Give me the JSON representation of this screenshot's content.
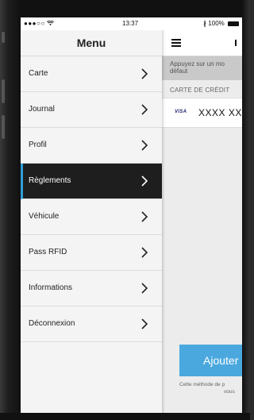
{
  "status_bar": {
    "signal": "●●●○○",
    "time": "13:37",
    "battery_text": "100%"
  },
  "menu": {
    "title": "Menu",
    "items": [
      {
        "label": "Carte"
      },
      {
        "label": "Journal"
      },
      {
        "label": "Profil"
      },
      {
        "label": "Règlements"
      },
      {
        "label": "Véhicule"
      },
      {
        "label": "Pass RFID"
      },
      {
        "label": "Informations"
      },
      {
        "label": "Déconnexion"
      }
    ],
    "active_index": 3
  },
  "content": {
    "banner_line1": "Appuyez sur un mo",
    "banner_line2": "défaut",
    "section_title": "CARTE DE CRÉDIT",
    "card_brand": "VISA",
    "card_number": "XXXX XX",
    "add_button_label": "Ajouter u",
    "footnote_line1": "Cette méthode de p",
    "footnote_line2": "vous"
  },
  "colors": {
    "accent": "#4aa8de",
    "active_bg": "#1e1e1e",
    "active_bar": "#2f9fd8"
  }
}
